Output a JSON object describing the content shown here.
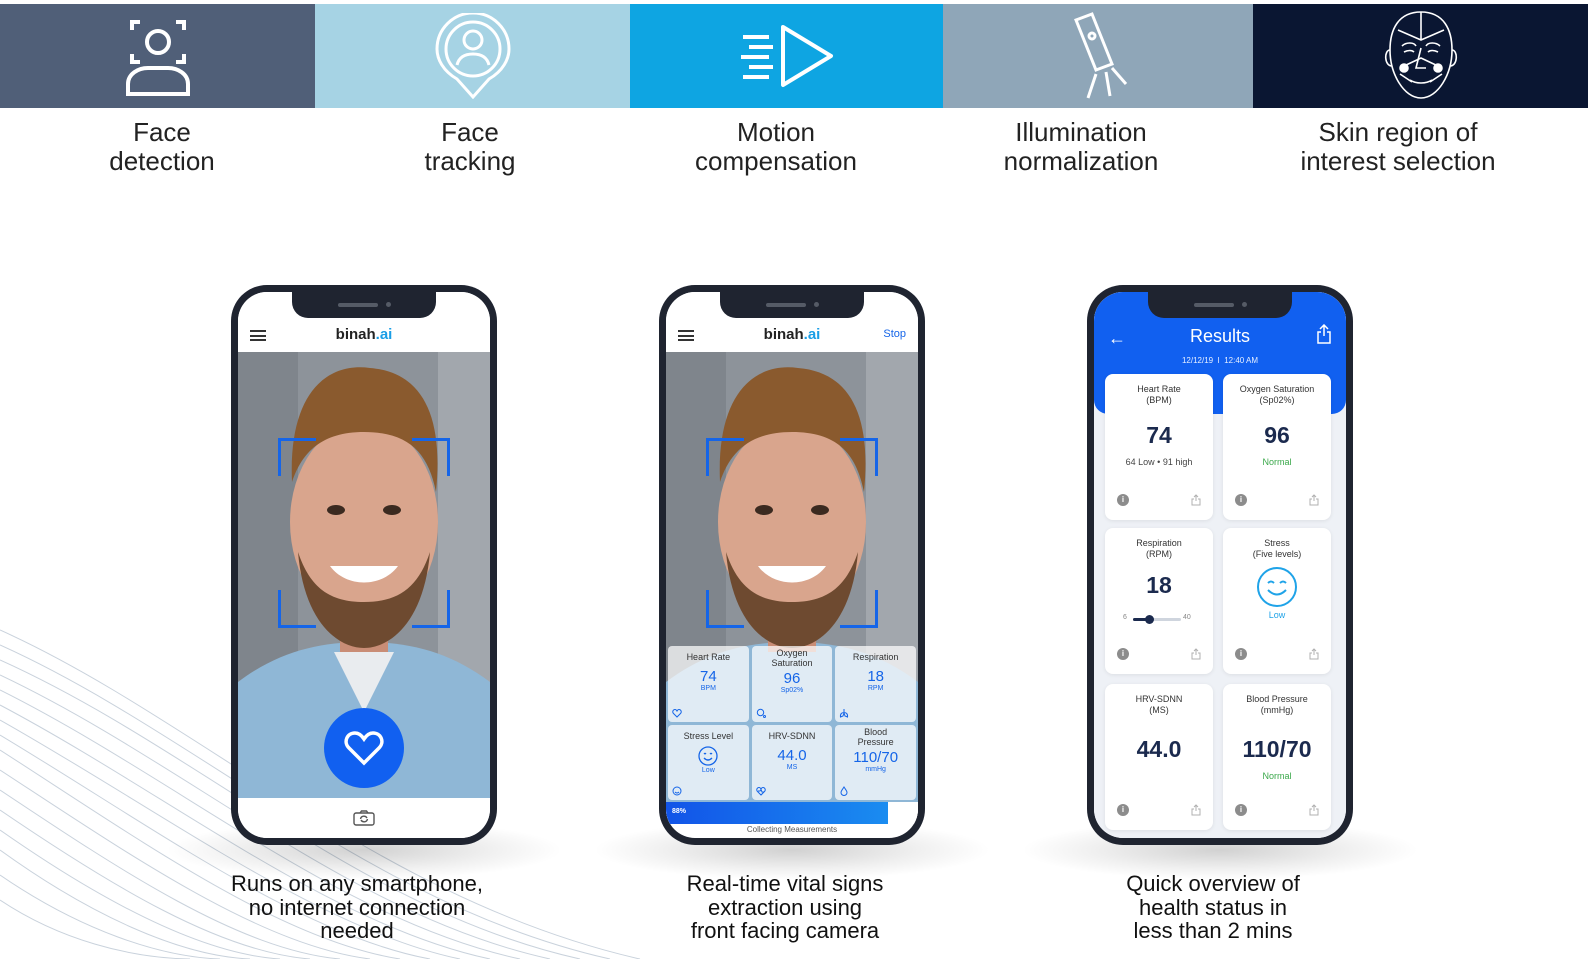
{
  "features": [
    {
      "icon": "face-detect-icon",
      "bg": "#505f78",
      "label_line1": "Face",
      "label_line2": "detection"
    },
    {
      "icon": "face-tracking-pin-icon",
      "bg": "#a6d3e4",
      "label_line1": "Face",
      "label_line2": "tracking"
    },
    {
      "icon": "motion-play-icon",
      "bg": "#0ea5e2",
      "label_line1": "Motion",
      "label_line2": "compensation"
    },
    {
      "icon": "flashlight-icon",
      "bg": "#8fa6b8",
      "label_line1": "Illumination",
      "label_line2": "normalization"
    },
    {
      "icon": "face-mesh-icon",
      "bg": "#0a1632",
      "label_line1": "Skin region of",
      "label_line2": "interest selection"
    }
  ],
  "phone1": {
    "brand": "binah",
    "brand_suffix": ".ai",
    "caption": [
      "Runs on any smartphone,",
      "no internet connection",
      "needed"
    ]
  },
  "phone2": {
    "brand": "binah",
    "brand_suffix": ".ai",
    "stop": "Stop",
    "vitals": [
      {
        "title": "Heart Rate",
        "value": "74",
        "unit": "BPM"
      },
      {
        "title": "Oxygen Saturation",
        "value": "96",
        "unit": "Sp02%"
      },
      {
        "title": "Respiration",
        "value": "18",
        "unit": "RPM"
      },
      {
        "title": "Stress Level",
        "value": "",
        "unit": "Low"
      },
      {
        "title": "HRV-SDNN",
        "value": "44.0",
        "unit": "MS"
      },
      {
        "title": "Blood Pressure",
        "value": "110/70",
        "unit": "mmHg"
      }
    ],
    "progress_label": "88%",
    "progress": 0.88,
    "collecting": "Collecting Measurements",
    "caption": [
      "Real-time vital signs",
      "extraction using",
      "front facing camera"
    ]
  },
  "phone3": {
    "title": "Results",
    "date": "12/12/19",
    "time": "12:40 AM",
    "cards": [
      {
        "title1": "Heart Rate",
        "title2": "(BPM)",
        "value": "74",
        "sub": "64 Low • 91 high"
      },
      {
        "title1": "Oxygen Saturation",
        "title2": "(Sp02%)",
        "value": "96",
        "sub": "Normal"
      },
      {
        "title1": "Respiration",
        "title2": "(RPM)",
        "value": "18",
        "slider_min": "6",
        "slider_max": "40"
      },
      {
        "title1": "Stress",
        "title2": "(Five levels)",
        "sub": "Low"
      },
      {
        "title1": "HRV-SDNN",
        "title2": "(MS)",
        "value": "44.0"
      },
      {
        "title1": "Blood Pressure",
        "title2": "(mmHg)",
        "value": "110/70",
        "sub": "Normal"
      }
    ],
    "caption": [
      "Quick overview of",
      "health status in",
      "less than 2 mins"
    ]
  },
  "colors": {
    "accent": "#1160f0",
    "ai_blue": "#1a9ee6",
    "normal_green": "#3aa84a",
    "navy_value": "#1b2a4e"
  }
}
